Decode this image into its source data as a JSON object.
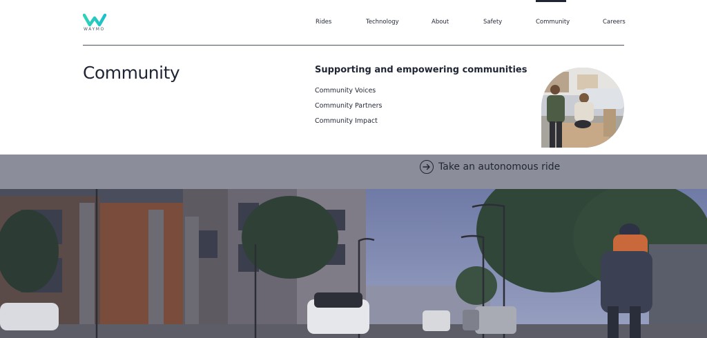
{
  "brand": {
    "name": "WAYMO",
    "colors": {
      "teal": "#2ed3b7",
      "blue": "#3a7ad9",
      "text": "#1f2533"
    }
  },
  "nav": {
    "items": [
      {
        "label": "Rides"
      },
      {
        "label": "Technology"
      },
      {
        "label": "About"
      },
      {
        "label": "Safety"
      },
      {
        "label": "Community",
        "active": true
      },
      {
        "label": "Careers"
      }
    ]
  },
  "panel": {
    "title": "Community",
    "subtitle": "Supporting and empowering communities",
    "links": [
      {
        "label": "Community Voices"
      },
      {
        "label": "Community Partners"
      },
      {
        "label": "Community Impact"
      }
    ]
  },
  "hero": {
    "cta_label": "Take an autonomous ride",
    "cta_icon": "arrow-right-circle-icon"
  }
}
